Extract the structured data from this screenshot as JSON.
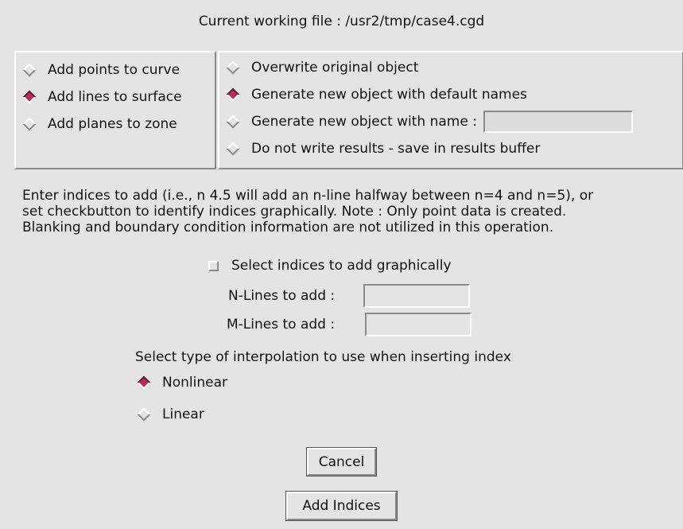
{
  "title": "Current working file : /usr2/tmp/case4.cgd",
  "add_mode": {
    "selected": 1,
    "options": [
      {
        "label": "Add points to curve"
      },
      {
        "label": "Add lines to surface"
      },
      {
        "label": "Add planes to zone"
      }
    ]
  },
  "output_mode": {
    "selected": 1,
    "options": [
      {
        "label": "Overwrite original object"
      },
      {
        "label": "Generate new object with default names"
      },
      {
        "label": "Generate new object with name :"
      },
      {
        "label": "Do not write results - save in results buffer"
      }
    ],
    "name_value": ""
  },
  "description": [
    "Enter indices to add (i.e.,  n 4.5 will add an n-line halfway between n=4 and n=5), or",
    "set  checkbutton to identify indices graphically. Note : Only point data is  created.",
    "Blanking and boundary condition information are not utilized in  this operation."
  ],
  "select_graphically": {
    "label": "Select indices to add graphically",
    "checked": false
  },
  "n_lines": {
    "label": "N-Lines to add :",
    "value": ""
  },
  "m_lines": {
    "label": "M-Lines to add :",
    "value": ""
  },
  "interp": {
    "heading": "Select type of interpolation to use when inserting index",
    "selected": 0,
    "options": [
      {
        "label": "Nonlinear"
      },
      {
        "label": "Linear"
      }
    ]
  },
  "buttons": {
    "cancel": "Cancel",
    "add_indices": "Add Indices"
  }
}
